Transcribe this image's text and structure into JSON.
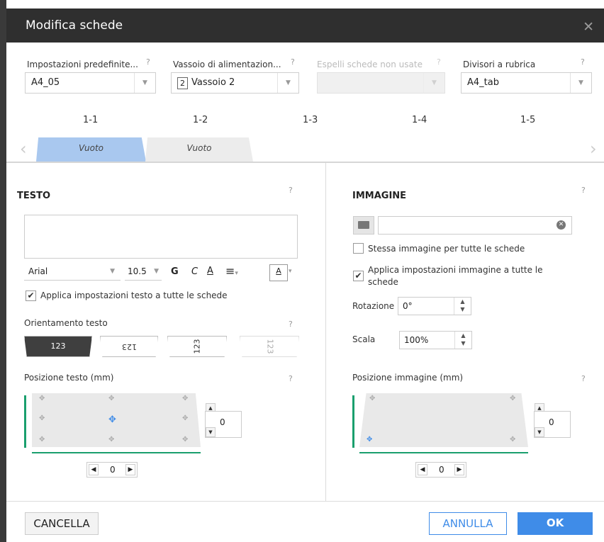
{
  "title": "Modifica schede",
  "fields": {
    "preset": {
      "label": "Impostazioni predefinite...",
      "help": "?",
      "value": "A4_05"
    },
    "tray": {
      "label": "Vassoio di alimentazion...",
      "help": "?",
      "badge": "2",
      "value": "Vassoio 2"
    },
    "eject": {
      "label": "Espelli schede non usate",
      "help": "?",
      "value": ""
    },
    "dividers": {
      "label": "Divisori a rubrica",
      "help": "?",
      "value": "A4_tab"
    }
  },
  "tabs": {
    "numbers": [
      "1-1",
      "1-2",
      "1-3",
      "1-4",
      "1-5"
    ],
    "items": [
      {
        "label": "Vuoto"
      },
      {
        "label": "Vuoto"
      }
    ],
    "prev": "‹",
    "next": "›"
  },
  "text": {
    "header": "TESTO",
    "help": "?",
    "font": "Arial",
    "size": "10.5",
    "bold": "G",
    "italic": "C",
    "underline": "A",
    "color_glyph": "A",
    "apply_all": "Applica impostazioni testo a tutte le schede",
    "orientation": {
      "label": "Orientamento testo",
      "help": "?",
      "options": [
        "123",
        "123",
        "123",
        "123"
      ]
    },
    "position": {
      "label": "Posizione testo (mm)",
      "help": "?",
      "vertical_value": "0",
      "horizontal_value": "0"
    }
  },
  "image": {
    "header": "IMMAGINE",
    "help": "?",
    "same_image": "Stessa immagine per tutte le schede",
    "apply_all": "Applica impostazioni immagine a tutte le schede",
    "rotation": {
      "label": "Rotazione",
      "value": "0°"
    },
    "scale": {
      "label": "Scala",
      "value": "100%"
    },
    "position": {
      "label": "Posizione immagine (mm)",
      "help": "?",
      "vertical_value": "0",
      "horizontal_value": "0"
    }
  },
  "footer": {
    "clear": "CANCELLA",
    "cancel": "ANNULLA",
    "ok": "OK"
  },
  "colors": {
    "accent": "#3f8ce8",
    "tab_active": "#a9c8ef",
    "titlebar": "#2f2f2f",
    "arrow_green": "#1a9f6e"
  }
}
